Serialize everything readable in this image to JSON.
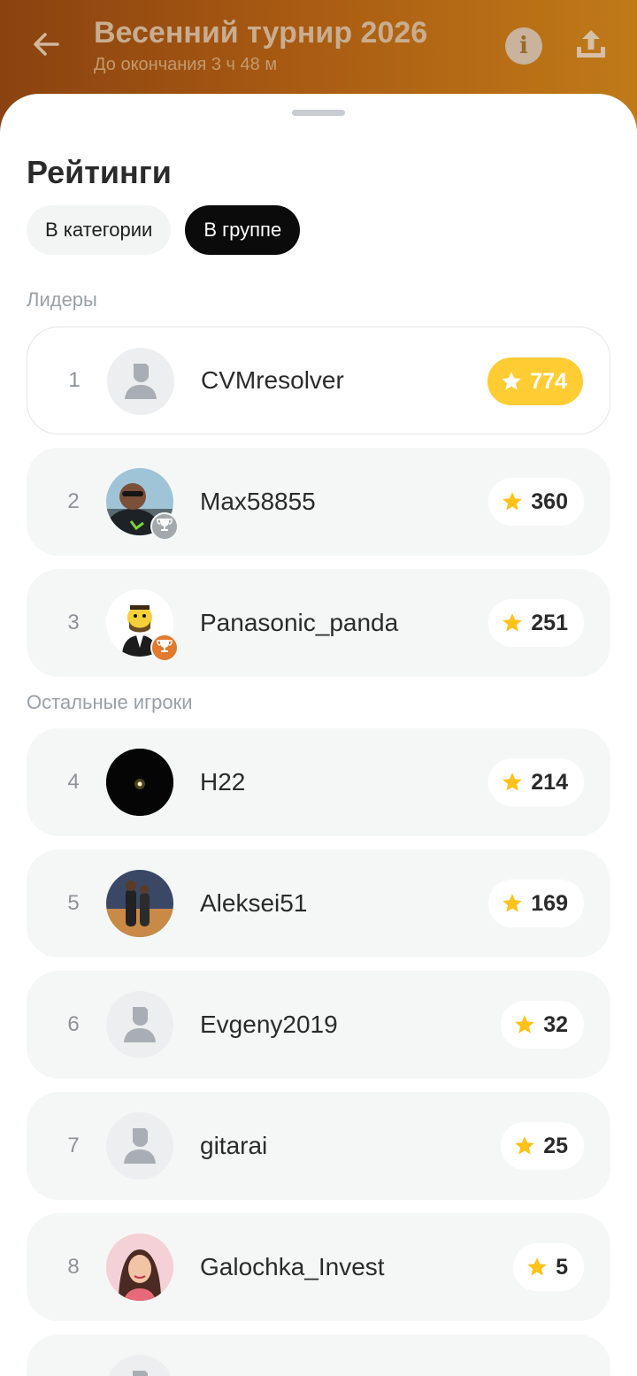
{
  "header": {
    "title": "Весенний турнир 2026",
    "subtitle": "До окончания 3 ч 48 м",
    "info_glyph": "i"
  },
  "sheet": {
    "title": "Рейтинги",
    "tabs": [
      {
        "label": "В категории",
        "active": false
      },
      {
        "label": "В группе",
        "active": true
      }
    ],
    "leaders_label": "Лидеры",
    "others_label": "Остальные игроки"
  },
  "colors": {
    "accent_gold": "#ffcc33",
    "star": "#ffc21a",
    "silver_medal": "#a3a8ad",
    "bronze_medal": "#e07a2e",
    "header_gradient": "#a85a12"
  },
  "icons": {
    "back": "arrow-left-icon",
    "info": "info-icon",
    "share": "share-upload-icon",
    "star": "star-icon",
    "trophy": "trophy-icon",
    "placeholder_avatar": "user-placeholder-icon"
  },
  "players": [
    {
      "rank": "1",
      "name": "CVMresolver",
      "score": "774",
      "avatar": "placeholder"
    },
    {
      "rank": "2",
      "name": "Max58855",
      "score": "360",
      "avatar": "photo",
      "medal": "silver"
    },
    {
      "rank": "3",
      "name": "Panasonic_panda",
      "score": "251",
      "avatar": "cartoon",
      "medal": "bronze"
    },
    {
      "rank": "4",
      "name": "H22",
      "score": "214",
      "avatar": "dark"
    },
    {
      "rank": "5",
      "name": "Aleksei51",
      "score": "169",
      "avatar": "photo"
    },
    {
      "rank": "6",
      "name": "Evgeny2019",
      "score": "32",
      "avatar": "placeholder"
    },
    {
      "rank": "7",
      "name": "gitarai",
      "score": "25",
      "avatar": "placeholder"
    },
    {
      "rank": "8",
      "name": "Galochka_Invest",
      "score": "5",
      "avatar": "photo"
    }
  ]
}
